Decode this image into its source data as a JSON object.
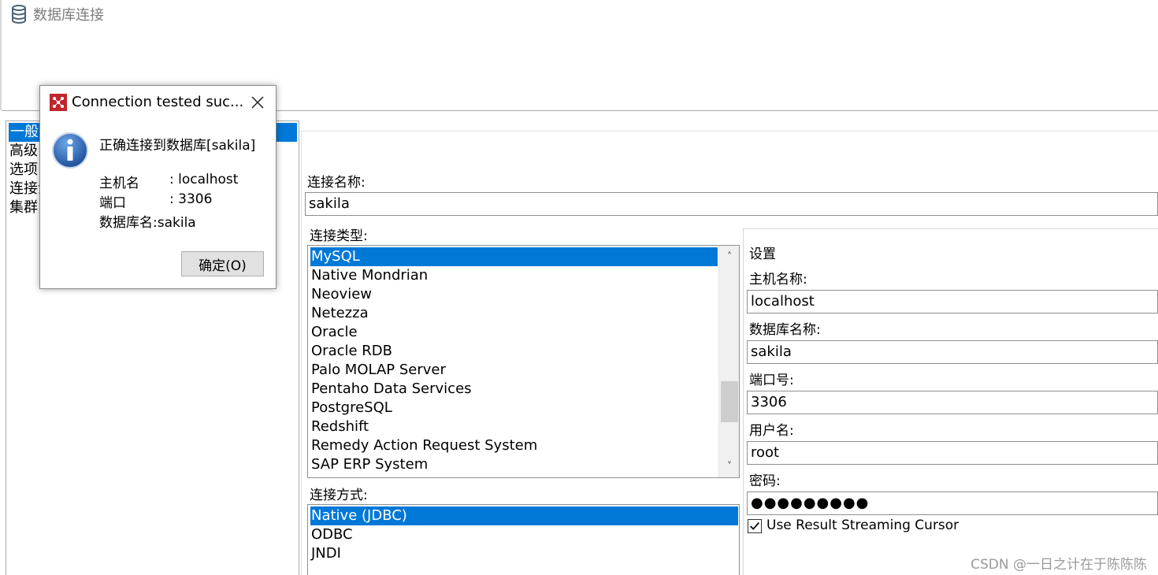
{
  "window": {
    "title": "数据库连接"
  },
  "nav": {
    "items": [
      "一般",
      "高级",
      "选项",
      "连接池",
      "集群"
    ],
    "selected_index": 0
  },
  "form": {
    "connection_name_label": "连接名称:",
    "connection_name_value": "sakila",
    "connection_type_label": "连接类型:",
    "connection_types": [
      "MySQL",
      "Native Mondrian",
      "Neoview",
      "Netezza",
      "Oracle",
      "Oracle RDB",
      "Palo MOLAP Server",
      "Pentaho Data Services",
      "PostgreSQL",
      "Redshift",
      "Remedy Action Request System",
      "SAP ERP System"
    ],
    "connection_type_selected": "MySQL",
    "access_label": "连接方式:",
    "access_methods": [
      "Native (JDBC)",
      "ODBC",
      "JNDI"
    ],
    "access_selected": "Native (JDBC)"
  },
  "settings": {
    "title": "设置",
    "host_label": "主机名称:",
    "host_value": "localhost",
    "dbname_label": "数据库名称:",
    "dbname_value": "sakila",
    "port_label": "端口号:",
    "port_value": "3306",
    "user_label": "用户名:",
    "user_value": "root",
    "password_label": "密码:",
    "password_value": "●●●●●●●●●",
    "streaming_label": "Use Result Streaming Cursor",
    "streaming_checked": true
  },
  "dialog": {
    "title": "Connection tested suc...",
    "message": "正确连接到数据库[sakila]",
    "host_line_label": "主机名",
    "host_line_value": ": localhost",
    "port_line_label": "端口",
    "port_line_value": ": 3306",
    "db_line": "数据库名:sakila",
    "ok_label": "确定(O)"
  },
  "watermark": "CSDN @一日之计在于陈陈陈",
  "colors": {
    "selection": "#0078d7",
    "dialog_icon": "#c0262d",
    "info_icon": "#1f5fa8"
  }
}
